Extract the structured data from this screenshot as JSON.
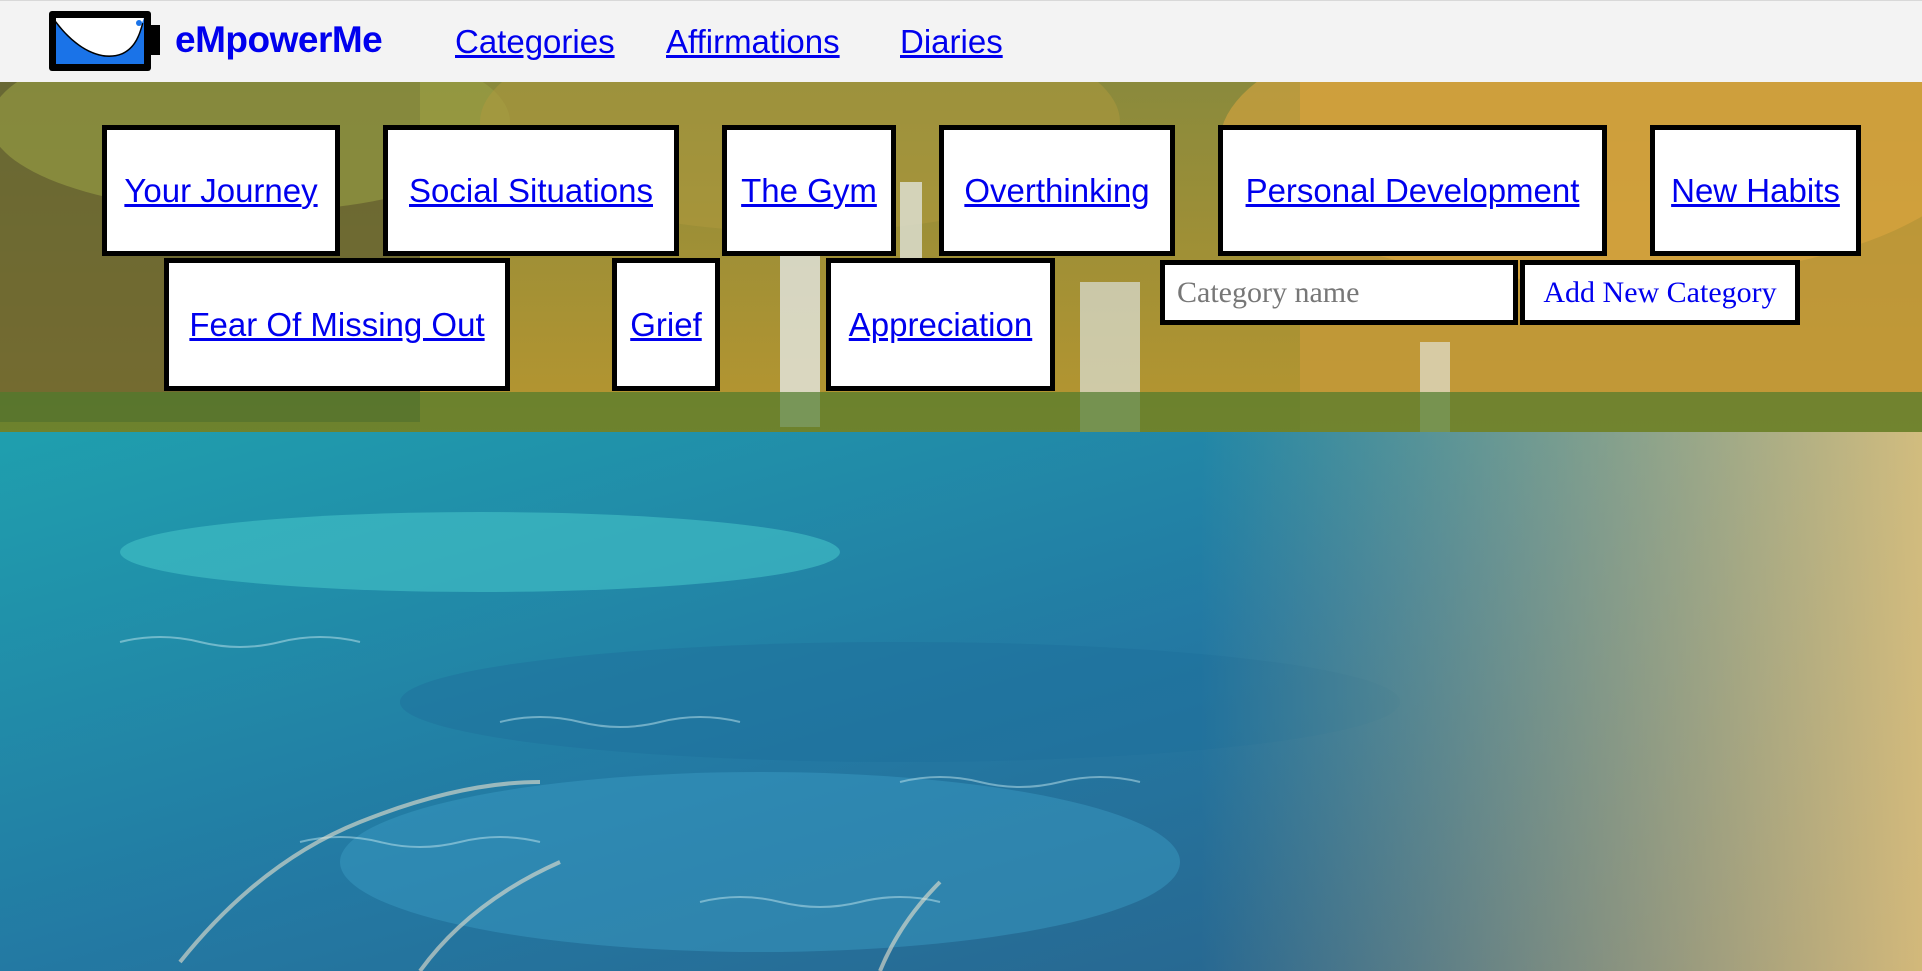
{
  "nav": {
    "brand": "eMpowerMe",
    "links": [
      "Categories",
      "Affirmations",
      "Diaries"
    ]
  },
  "categories": [
    "Your Journey",
    "Social Situations",
    "The Gym",
    "Overthinking",
    "Personal Development",
    "New Habits",
    "Fear Of Missing Out",
    "Grief",
    "Appreciation"
  ],
  "add_category": {
    "placeholder": "Category name",
    "button_label": "Add New Category"
  },
  "colors": {
    "link": "#0000ee",
    "logo_fill": "#1a73e8",
    "card_border": "#000000",
    "card_bg": "#ffffff"
  },
  "icons": {
    "logo": "battery-logo-icon"
  }
}
